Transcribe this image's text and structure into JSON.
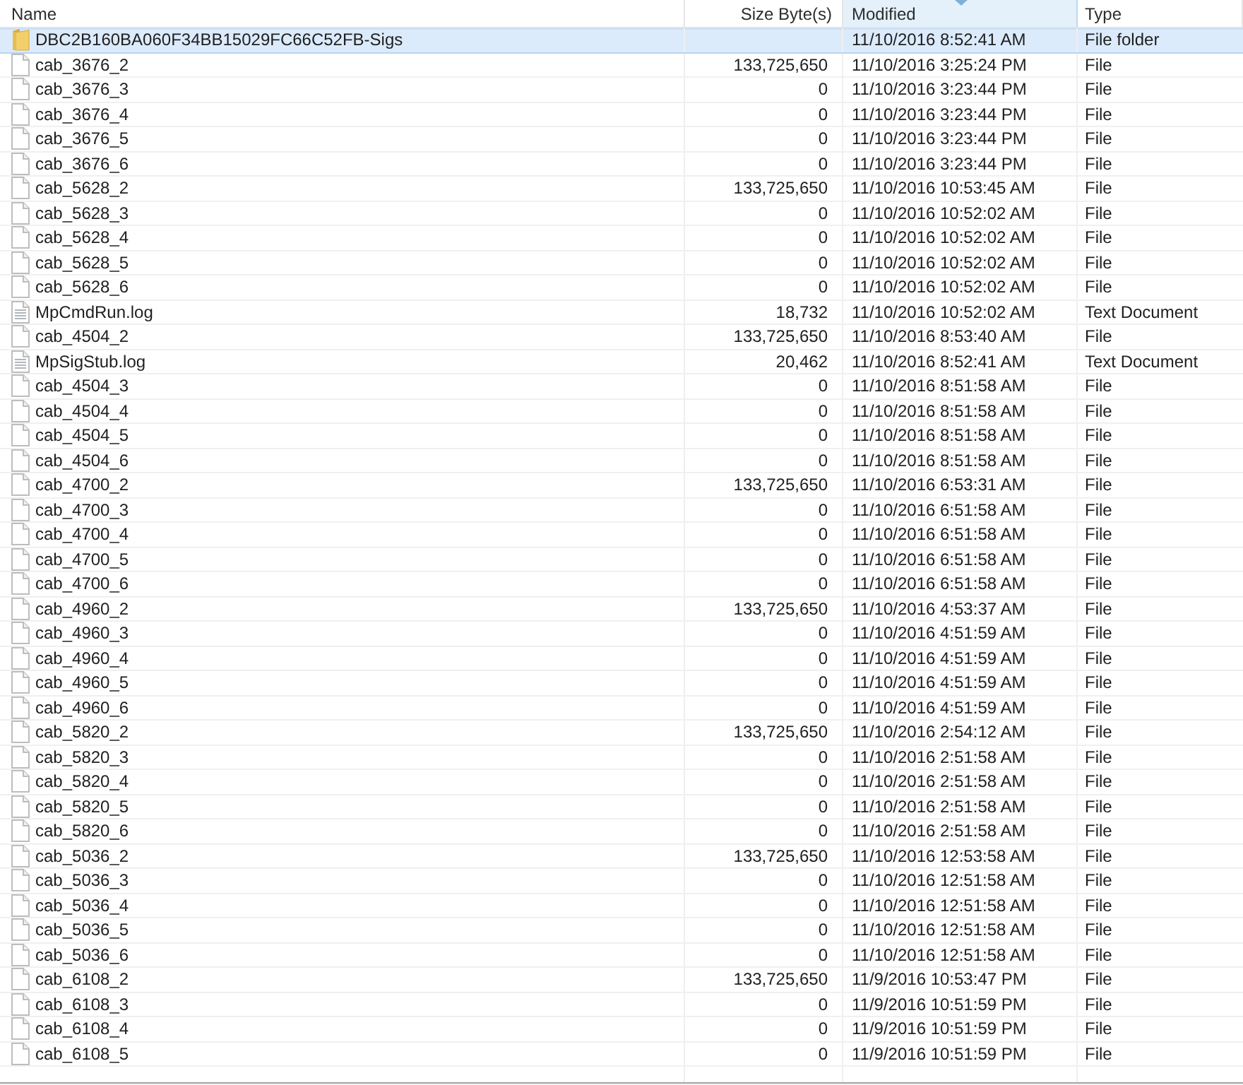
{
  "columns": [
    {
      "label": "Name",
      "sorted": false
    },
    {
      "label": "Size Byte(s)",
      "sorted": false
    },
    {
      "label": "Modified",
      "sorted": true
    },
    {
      "label": "Type",
      "sorted": false
    }
  ],
  "rows": [
    {
      "kind": "folder",
      "name": "DBC2B160BA060F34BB15029FC66C52FB-Sigs",
      "modified": "11/10/2016 8:52:41 AM",
      "type": "File folder",
      "selected": true
    },
    {
      "kind": "file",
      "name": "cab_3676_2",
      "size": "133,725,650",
      "modified": "11/10/2016 3:25:24 PM",
      "type": "File",
      "selected": false
    },
    {
      "kind": "file",
      "name": "cab_3676_3",
      "size": "0",
      "modified": "11/10/2016 3:23:44 PM",
      "type": "File",
      "selected": false
    },
    {
      "kind": "file",
      "name": "cab_3676_4",
      "size": "0",
      "modified": "11/10/2016 3:23:44 PM",
      "type": "File",
      "selected": false
    },
    {
      "kind": "file",
      "name": "cab_3676_5",
      "size": "0",
      "modified": "11/10/2016 3:23:44 PM",
      "type": "File",
      "selected": false
    },
    {
      "kind": "file",
      "name": "cab_3676_6",
      "size": "0",
      "modified": "11/10/2016 3:23:44 PM",
      "type": "File",
      "selected": false
    },
    {
      "kind": "file",
      "name": "cab_5628_2",
      "size": "133,725,650",
      "modified": "11/10/2016 10:53:45 AM",
      "type": "File",
      "selected": false
    },
    {
      "kind": "file",
      "name": "cab_5628_3",
      "size": "0",
      "modified": "11/10/2016 10:52:02 AM",
      "type": "File",
      "selected": false
    },
    {
      "kind": "file",
      "name": "cab_5628_4",
      "size": "0",
      "modified": "11/10/2016 10:52:02 AM",
      "type": "File",
      "selected": false
    },
    {
      "kind": "file",
      "name": "cab_5628_5",
      "size": "0",
      "modified": "11/10/2016 10:52:02 AM",
      "type": "File",
      "selected": false
    },
    {
      "kind": "file",
      "name": "cab_5628_6",
      "size": "0",
      "modified": "11/10/2016 10:52:02 AM",
      "type": "File",
      "selected": false
    },
    {
      "kind": "text",
      "name": "MpCmdRun.log",
      "size": "18,732",
      "modified": "11/10/2016 10:52:02 AM",
      "type": "Text Document",
      "selected": false
    },
    {
      "kind": "file",
      "name": "cab_4504_2",
      "size": "133,725,650",
      "modified": "11/10/2016 8:53:40 AM",
      "type": "File",
      "selected": false
    },
    {
      "kind": "text",
      "name": "MpSigStub.log",
      "size": "20,462",
      "modified": "11/10/2016 8:52:41 AM",
      "type": "Text Document",
      "selected": false
    },
    {
      "kind": "file",
      "name": "cab_4504_3",
      "size": "0",
      "modified": "11/10/2016 8:51:58 AM",
      "type": "File",
      "selected": false
    },
    {
      "kind": "file",
      "name": "cab_4504_4",
      "size": "0",
      "modified": "11/10/2016 8:51:58 AM",
      "type": "File",
      "selected": false
    },
    {
      "kind": "file",
      "name": "cab_4504_5",
      "size": "0",
      "modified": "11/10/2016 8:51:58 AM",
      "type": "File",
      "selected": false
    },
    {
      "kind": "file",
      "name": "cab_4504_6",
      "size": "0",
      "modified": "11/10/2016 8:51:58 AM",
      "type": "File",
      "selected": false
    },
    {
      "kind": "file",
      "name": "cab_4700_2",
      "size": "133,725,650",
      "modified": "11/10/2016 6:53:31 AM",
      "type": "File",
      "selected": false
    },
    {
      "kind": "file",
      "name": "cab_4700_3",
      "size": "0",
      "modified": "11/10/2016 6:51:58 AM",
      "type": "File",
      "selected": false
    },
    {
      "kind": "file",
      "name": "cab_4700_4",
      "size": "0",
      "modified": "11/10/2016 6:51:58 AM",
      "type": "File",
      "selected": false
    },
    {
      "kind": "file",
      "name": "cab_4700_5",
      "size": "0",
      "modified": "11/10/2016 6:51:58 AM",
      "type": "File",
      "selected": false
    },
    {
      "kind": "file",
      "name": "cab_4700_6",
      "size": "0",
      "modified": "11/10/2016 6:51:58 AM",
      "type": "File",
      "selected": false
    },
    {
      "kind": "file",
      "name": "cab_4960_2",
      "size": "133,725,650",
      "modified": "11/10/2016 4:53:37 AM",
      "type": "File",
      "selected": false
    },
    {
      "kind": "file",
      "name": "cab_4960_3",
      "size": "0",
      "modified": "11/10/2016 4:51:59 AM",
      "type": "File",
      "selected": false
    },
    {
      "kind": "file",
      "name": "cab_4960_4",
      "size": "0",
      "modified": "11/10/2016 4:51:59 AM",
      "type": "File",
      "selected": false
    },
    {
      "kind": "file",
      "name": "cab_4960_5",
      "size": "0",
      "modified": "11/10/2016 4:51:59 AM",
      "type": "File",
      "selected": false
    },
    {
      "kind": "file",
      "name": "cab_4960_6",
      "size": "0",
      "modified": "11/10/2016 4:51:59 AM",
      "type": "File",
      "selected": false
    },
    {
      "kind": "file",
      "name": "cab_5820_2",
      "size": "133,725,650",
      "modified": "11/10/2016 2:54:12 AM",
      "type": "File",
      "selected": false
    },
    {
      "kind": "file",
      "name": "cab_5820_3",
      "size": "0",
      "modified": "11/10/2016 2:51:58 AM",
      "type": "File",
      "selected": false
    },
    {
      "kind": "file",
      "name": "cab_5820_4",
      "size": "0",
      "modified": "11/10/2016 2:51:58 AM",
      "type": "File",
      "selected": false
    },
    {
      "kind": "file",
      "name": "cab_5820_5",
      "size": "0",
      "modified": "11/10/2016 2:51:58 AM",
      "type": "File",
      "selected": false
    },
    {
      "kind": "file",
      "name": "cab_5820_6",
      "size": "0",
      "modified": "11/10/2016 2:51:58 AM",
      "type": "File",
      "selected": false
    },
    {
      "kind": "file",
      "name": "cab_5036_2",
      "size": "133,725,650",
      "modified": "11/10/2016 12:53:58 AM",
      "type": "File",
      "selected": false
    },
    {
      "kind": "file",
      "name": "cab_5036_3",
      "size": "0",
      "modified": "11/10/2016 12:51:58 AM",
      "type": "File",
      "selected": false
    },
    {
      "kind": "file",
      "name": "cab_5036_4",
      "size": "0",
      "modified": "11/10/2016 12:51:58 AM",
      "type": "File",
      "selected": false
    },
    {
      "kind": "file",
      "name": "cab_5036_5",
      "size": "0",
      "modified": "11/10/2016 12:51:58 AM",
      "type": "File",
      "selected": false
    },
    {
      "kind": "file",
      "name": "cab_5036_6",
      "size": "0",
      "modified": "11/10/2016 12:51:58 AM",
      "type": "File",
      "selected": false
    },
    {
      "kind": "file",
      "name": "cab_6108_2",
      "size": "133,725,650",
      "modified": "11/9/2016 10:53:47 PM",
      "type": "File",
      "selected": false
    },
    {
      "kind": "file",
      "name": "cab_6108_3",
      "size": "0",
      "modified": "11/9/2016 10:51:59 PM",
      "type": "File",
      "selected": false
    },
    {
      "kind": "file",
      "name": "cab_6108_4",
      "size": "0",
      "modified": "11/9/2016 10:51:59 PM",
      "type": "File",
      "selected": false
    },
    {
      "kind": "file",
      "name": "cab_6108_5",
      "size": "0",
      "modified": "11/9/2016 10:51:59 PM",
      "type": "File",
      "selected": false
    }
  ]
}
